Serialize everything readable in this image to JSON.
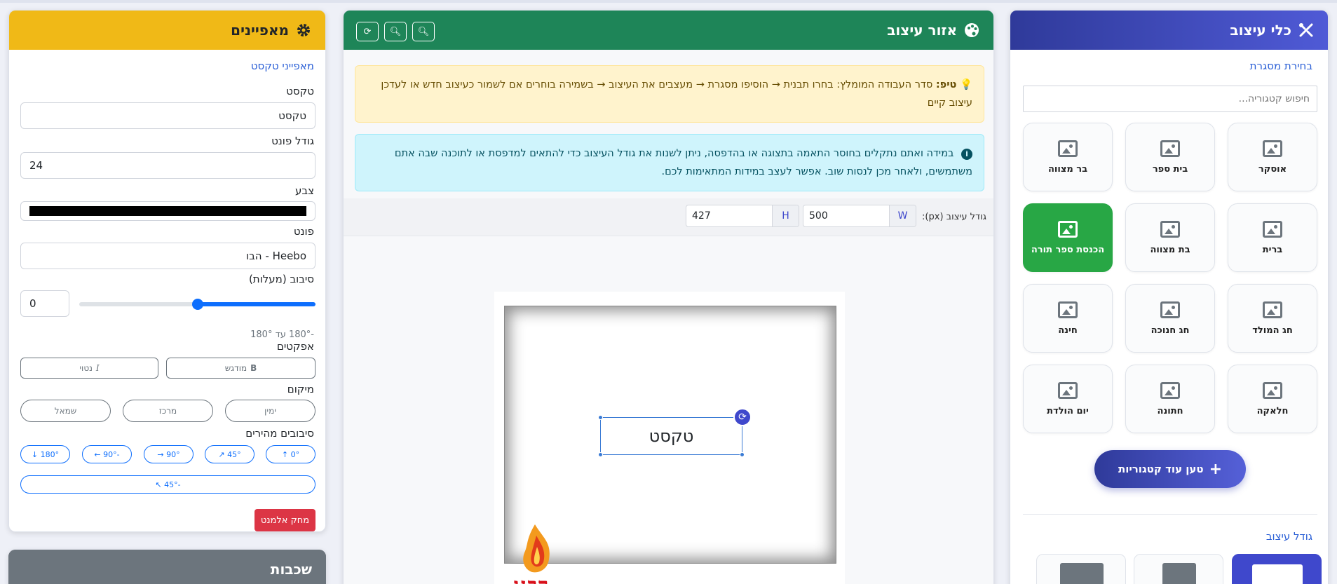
{
  "tools": {
    "title": "כלי עיצוב",
    "choose_frame": "בחירת מסגרת",
    "search_placeholder": "חיפוש קטגוריה...",
    "categories": [
      {
        "label": "אוסקר",
        "selected": false
      },
      {
        "label": "בית ספר",
        "selected": false
      },
      {
        "label": "בר מצווה",
        "selected": false
      },
      {
        "label": "ברית",
        "selected": false
      },
      {
        "label": "בת מצווה",
        "selected": false
      },
      {
        "label": "הכנסת ספר תורה",
        "selected": true
      },
      {
        "label": "חג המולד",
        "selected": false
      },
      {
        "label": "חג חנוכה",
        "selected": false
      },
      {
        "label": "חינה",
        "selected": false
      },
      {
        "label": "חלאקה",
        "selected": false
      },
      {
        "label": "חתונה",
        "selected": false
      },
      {
        "label": "יום הולדת",
        "selected": false
      }
    ],
    "load_more": "טען עוד קטגוריות",
    "design_size": "גודל עיצוב"
  },
  "canvas": {
    "title": "אזור עיצוב",
    "tip_label": "טיפ:",
    "tip_text": "סדר העבודה המומלץ: בחרו תבנית → הוסיפו מסגרת → מעצבים את העיצוב → בשמירה בוחרים אם לשמור כעיצוב חדש או לעדכן עיצוב קיים",
    "info_text": "במידה ואתם נתקלים בחוסר התאמה בתצוגה או בהדפסה, ניתן לשנות את גודל העיצוב כדי להתאים למדפסת או לתוכנה שבה אתם משתמשים, ולאחר מכן לנסות שוב. אפשר לעצב במידות המתאימות לכם.",
    "size_label": "גודל עיצוב (px):",
    "width_tag": "W",
    "width_value": "500",
    "height_tag": "H",
    "height_value": "427",
    "text_element": "טקסט",
    "logo_text": "רבנו"
  },
  "props": {
    "title": "מאפיינים",
    "section": "מאפייני טקסט",
    "text_label": "טקסט",
    "text_value": "טקסט",
    "font_size_label": "גודל פונט",
    "font_size_value": "24",
    "color_label": "צבע",
    "color_value": "#000000",
    "font_label": "פונט",
    "font_value": "Heebo - הבו",
    "rotation_label": "סיבוב (מעלות)",
    "rotation_value": "0",
    "rotation_slider": 0.5,
    "rotation_hint": "-180° עד 180°",
    "effects_label": "אפקטים",
    "bold": "מודגש",
    "italic": "נטוי",
    "position_label": "מיקום",
    "pos_right": "ימין",
    "pos_center": "מרכז",
    "pos_left": "שמאל",
    "quick_rot_label": "סיבובים מהירים",
    "quick": [
      "0° ↑",
      "45° ↗",
      "90° →",
      "-90° ←",
      "180° ↓"
    ],
    "quick_extra": "-45° ↖",
    "delete": "מחק אלמנט"
  },
  "layers": {
    "title": "שכבות"
  }
}
